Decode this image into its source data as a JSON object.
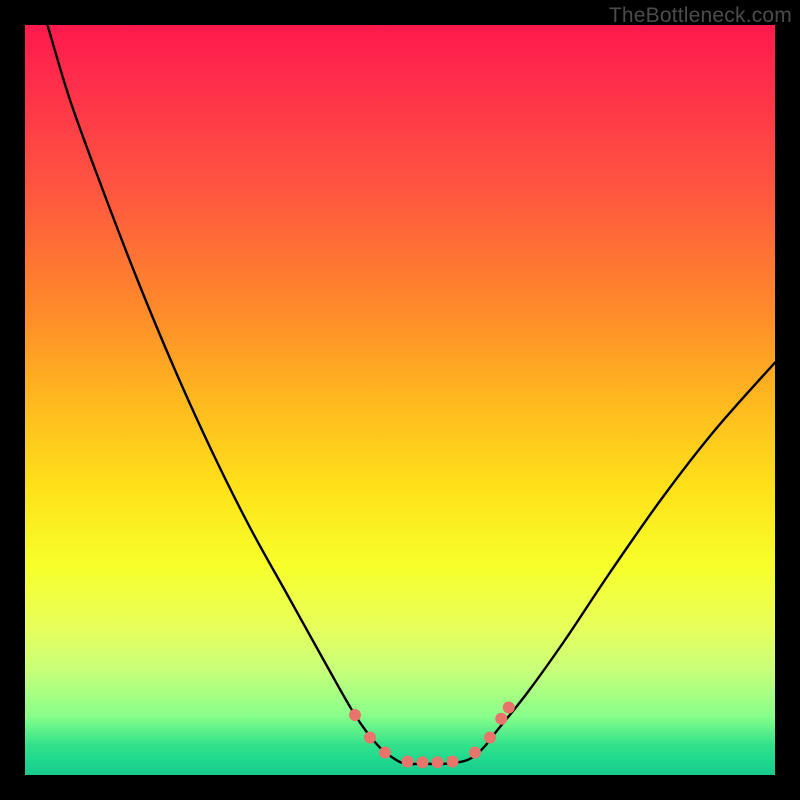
{
  "watermark": "TheBottleneck.com",
  "chart_data": {
    "type": "line",
    "title": "",
    "xlabel": "",
    "ylabel": "",
    "xlim": [
      0,
      100
    ],
    "ylim": [
      0,
      100
    ],
    "grid": false,
    "series": [
      {
        "name": "bottleneck-curve",
        "x": [
          3,
          6,
          10,
          15,
          20,
          25,
          30,
          35,
          40,
          44,
          47,
          49.5,
          51,
          53,
          56,
          59,
          61,
          63,
          67,
          72,
          78,
          85,
          92,
          100
        ],
        "y": [
          100,
          90,
          79,
          66,
          54,
          43,
          33,
          24,
          15,
          8,
          4,
          2,
          1.5,
          1.5,
          1.5,
          2,
          3.5,
          6,
          11,
          18,
          27,
          37,
          46,
          55
        ]
      }
    ],
    "markers": [
      {
        "name": "dot-left-1",
        "x": 44,
        "y": 8
      },
      {
        "name": "dot-left-2",
        "x": 46,
        "y": 5
      },
      {
        "name": "dot-left-3",
        "x": 48,
        "y": 3
      },
      {
        "name": "dot-flat-1",
        "x": 51,
        "y": 1.8
      },
      {
        "name": "dot-flat-2",
        "x": 53,
        "y": 1.7
      },
      {
        "name": "dot-flat-3",
        "x": 55,
        "y": 1.7
      },
      {
        "name": "dot-flat-4",
        "x": 57,
        "y": 1.8
      },
      {
        "name": "dot-right-1",
        "x": 60,
        "y": 3
      },
      {
        "name": "dot-right-2",
        "x": 62,
        "y": 5
      },
      {
        "name": "dot-right-3",
        "x": 63.5,
        "y": 7.5
      },
      {
        "name": "dot-right-4",
        "x": 64.5,
        "y": 9
      }
    ],
    "background_gradient": {
      "type": "vertical",
      "stops": [
        {
          "pos": 0.0,
          "color": "#ff1a4d"
        },
        {
          "pos": 0.08,
          "color": "#ff2f4a"
        },
        {
          "pos": 0.22,
          "color": "#ff5640"
        },
        {
          "pos": 0.38,
          "color": "#ff8a2a"
        },
        {
          "pos": 0.5,
          "color": "#ffb81f"
        },
        {
          "pos": 0.62,
          "color": "#ffe21a"
        },
        {
          "pos": 0.72,
          "color": "#f7ff2a"
        },
        {
          "pos": 0.8,
          "color": "#e8ff5a"
        },
        {
          "pos": 0.86,
          "color": "#c8ff7a"
        },
        {
          "pos": 0.92,
          "color": "#8aff8a"
        },
        {
          "pos": 0.96,
          "color": "#33e28a"
        },
        {
          "pos": 0.98,
          "color": "#1fd98f"
        },
        {
          "pos": 1.0,
          "color": "#18c98d"
        }
      ]
    },
    "marker_style": {
      "color": "#e9746c",
      "radius": 6
    },
    "line_style": {
      "color": "#000000",
      "width": 2.4
    }
  }
}
